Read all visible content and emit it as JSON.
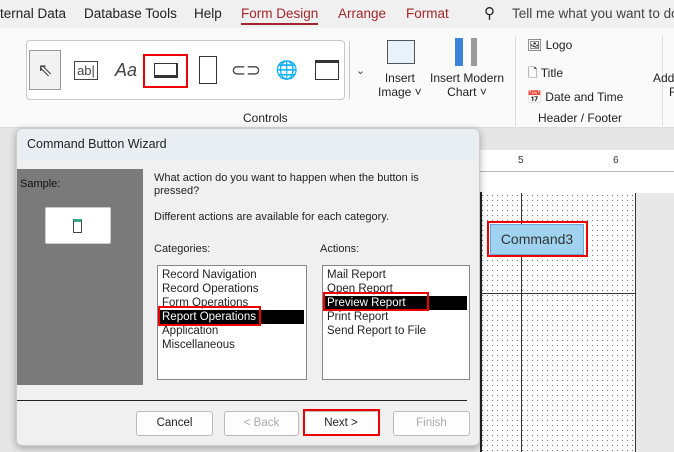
{
  "tabs": [
    "ternal Data",
    "Database Tools",
    "Help",
    "Form Design",
    "Arrange",
    "Format"
  ],
  "search": {
    "placeholder": "Tell me what you want to do"
  },
  "ribbon": {
    "insert_image": "Insert",
    "insert_image2": "Image ˅",
    "insert_chart": "Insert Modern",
    "insert_chart2": "Chart ˅",
    "controls_label": "Controls",
    "logo": "Logo",
    "title": "Title",
    "date_time": "Date and Time",
    "header_footer_label": "Header / Footer",
    "add": "Add",
    "add2": "F",
    "textbox": "ab|",
    "label": "Aa"
  },
  "ruler": [
    "5",
    "6"
  ],
  "design": {
    "command_button": "Command3"
  },
  "dialog": {
    "title": "Command Button Wizard",
    "sample_label": "Sample:",
    "question": "What action do you want to happen when the button is pressed?",
    "hint": "Different actions are available for each category.",
    "categories_label": "Categories:",
    "actions_label": "Actions:",
    "categories": [
      "Record Navigation",
      "Record Operations",
      "Form Operations",
      "Report Operations",
      "Application",
      "Miscellaneous"
    ],
    "actions": [
      "Mail Report",
      "Open Report",
      "Preview Report",
      "Print Report",
      "Send Report to File"
    ],
    "buttons": {
      "cancel": "Cancel",
      "back": "< Back",
      "next": "Next >",
      "finish": "Finish"
    }
  },
  "colors": {
    "accent": "#a4262c",
    "highlight": "#ff0000"
  }
}
